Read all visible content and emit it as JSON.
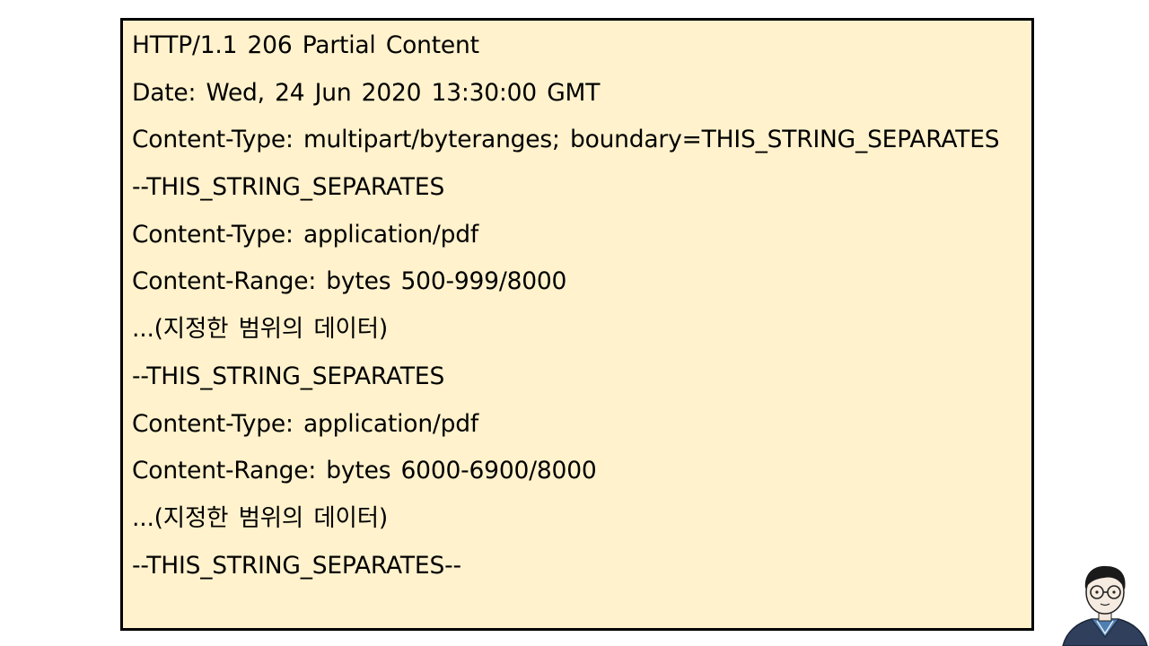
{
  "slide": {
    "lines": [
      "HTTP/1.1 206 Partial Content",
      "Date: Wed, 24 Jun 2020 13:30:00 GMT",
      "Content-Type: multipart/byteranges; boundary=THIS_STRING_SEPARATES",
      "--THIS_STRING_SEPARATES",
      "Content-Type: application/pdf",
      "Content-Range: bytes 500-999/8000",
      "...(지정한 범위의 데이터)",
      "--THIS_STRING_SEPARATES",
      "Content-Type: application/pdf",
      "Content-Range: bytes 6000-6900/8000",
      "...(지정한 범위의 데이터)",
      "--THIS_STRING_SEPARATES--"
    ],
    "box_background": "#fff2cc",
    "box_border": "#000000"
  },
  "presenter": {
    "icon": "presenter-avatar-icon"
  }
}
